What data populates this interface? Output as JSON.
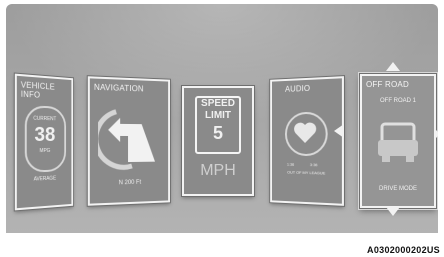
{
  "vehicle_info": {
    "title": "VEHICLE INFO",
    "current_label": "CURRENT",
    "value": "38",
    "unit": "MPG",
    "average_label": "AVERAGE"
  },
  "navigation": {
    "title": "NAVIGATION",
    "distance": "N 200 Ft"
  },
  "speed_limit": {
    "line1": "SPEED",
    "line2": "LIMIT",
    "value": "5",
    "unit": "MPH"
  },
  "audio": {
    "title": "AUDIO",
    "time_elapsed": "1:36",
    "time_total": "3:36",
    "track": "OUT OF MY LEAGUE",
    "favorite_icon": "heart-icon"
  },
  "off_road": {
    "title": "OFF ROAD",
    "subtitle": "OFF ROAD 1",
    "mode_label": "DRIVE MODE"
  },
  "figure_code": "A0302000202US",
  "colors": {
    "background": "#a3a3a3",
    "panel": "#8a8a8a",
    "text": "#f0f0f0"
  }
}
